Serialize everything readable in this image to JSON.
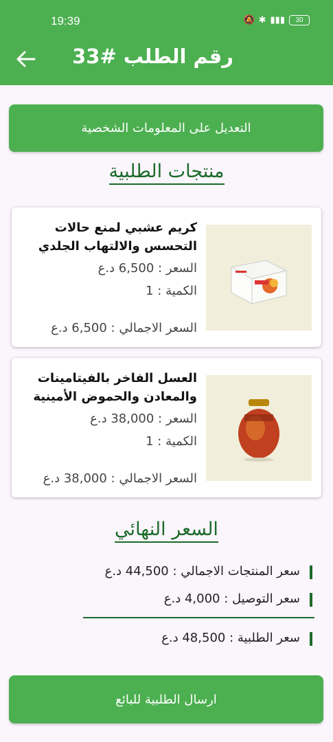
{
  "status_bar": {
    "time": "19:39",
    "battery": "30"
  },
  "header": {
    "title": "رقم الطلب #33",
    "back_icon": "arrow-left-icon"
  },
  "edit_button": {
    "label": "التعديل على المعلومات الشخصية"
  },
  "products_section": {
    "title": "منتجات الطلبية"
  },
  "products": [
    {
      "name": "كريم عشبي لمنع حالات التحسس والالتهاب الجلدي",
      "price": "السعر : 6,500 د.ع",
      "quantity": "الكمية : 1",
      "total": "السعر الاجمالي : 6,500 د.ع"
    },
    {
      "name": "العسل الفاخر بالفيتامينات والمعادن والحموض الأمينية",
      "price": "السعر : 38,000 د.ع",
      "quantity": "الكمية : 1",
      "total": "السعر الاجمالي : 38,000 د.ع"
    }
  ],
  "final_section": {
    "title": "السعر النهائي"
  },
  "summary": {
    "products_total": "سعر المنتجات الاجمالي : 44,500 د.ع",
    "delivery": "سعر التوصيل : 4,000 د.ع",
    "order_total": "سعر الطلبية : 48,500 د.ع"
  },
  "send_button": {
    "label": "ارسال الطلبية للبائع"
  },
  "colors": {
    "primary": "#4caf50",
    "accent_dark": "#1b6b2a",
    "background": "#fbf5fc"
  }
}
